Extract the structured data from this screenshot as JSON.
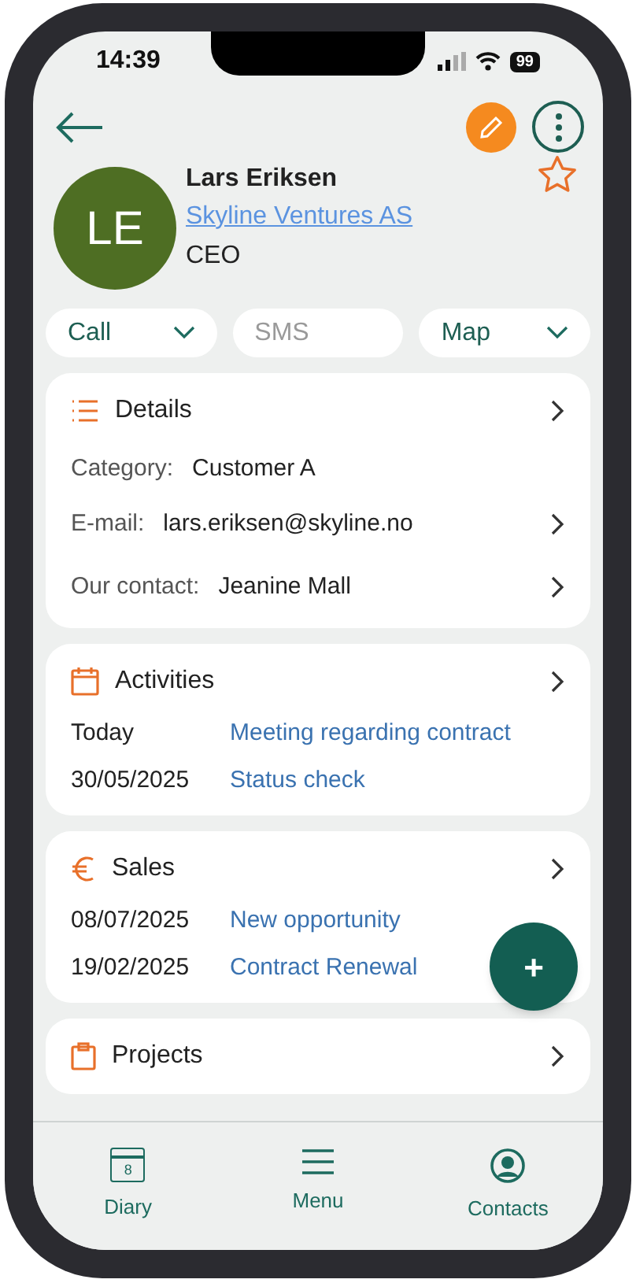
{
  "status_bar": {
    "time": "14:39",
    "battery": "99"
  },
  "contact": {
    "initials": "LE",
    "name": "Lars Eriksen",
    "company": "Skyline Ventures AS",
    "title": "CEO",
    "favorite": false
  },
  "actions": [
    {
      "label": "Call",
      "kind": "dropdown",
      "disabled": false
    },
    {
      "label": "SMS",
      "kind": "plain",
      "disabled": true
    },
    {
      "label": "Map",
      "kind": "dropdown",
      "disabled": false
    }
  ],
  "sections": [
    {
      "kind": "details",
      "title": "Details",
      "rows": [
        {
          "label": "Category:",
          "value": "Customer A",
          "has_arrow": false
        },
        {
          "label": "E-mail:",
          "value": "lars.eriksen@skyline.no",
          "has_arrow": true
        },
        {
          "label": "Our contact:",
          "value": "Jeanine Mall",
          "has_arrow": true
        }
      ]
    },
    {
      "kind": "activities",
      "title": "Activities",
      "items": [
        {
          "date": "Today",
          "text": "Meeting regarding contract"
        },
        {
          "date": "30/05/2025",
          "text": "Status check"
        }
      ]
    },
    {
      "kind": "sales",
      "title": "Sales",
      "items": [
        {
          "date": "08/07/2025",
          "text": "New opportunity"
        },
        {
          "date": "19/02/2025",
          "text": "Contract Renewal"
        }
      ]
    },
    {
      "kind": "projects",
      "title": "Projects"
    }
  ],
  "fab": {
    "label": "+"
  },
  "tab_bar": [
    {
      "kind": "diary",
      "label": "Diary",
      "day": "8"
    },
    {
      "kind": "menu",
      "label": "Menu"
    },
    {
      "kind": "contacts",
      "label": "Contacts"
    }
  ]
}
